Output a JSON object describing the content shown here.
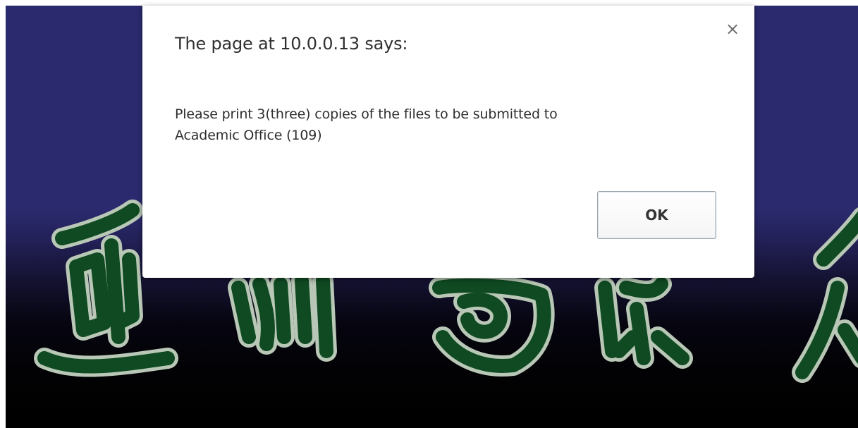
{
  "dialog": {
    "title": "The page at 10.0.0.13 says:",
    "close_glyph": "×",
    "message_line1": "Please print 3(three) copies of the files to be submitted to",
    "message_line2": "Academic Office (109)",
    "ok_label": "OK"
  },
  "background": {
    "characters": [
      "亞",
      "洲",
      "國",
      "際",
      "大"
    ],
    "top_color": "#2b2a6e",
    "bottom_color": "#000000",
    "calligraphy_fill": "#0f4a22",
    "calligraphy_outline": "#b8c7b6"
  },
  "icons": {
    "close": "close-icon"
  }
}
